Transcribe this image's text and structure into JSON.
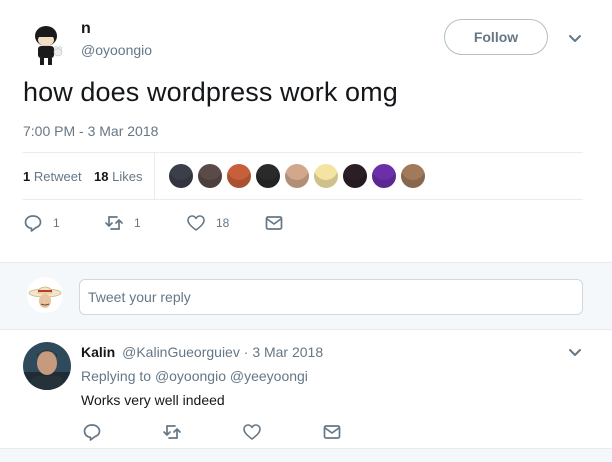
{
  "tweet": {
    "author_name": "n",
    "author_handle": "@oyoongio",
    "follow_label": "Follow",
    "text": "how does wordpress work omg",
    "timestamp": "7:00 PM - 3 Mar 2018",
    "retweets_count": "1",
    "retweets_label": "Retweet",
    "likes_count": "18",
    "likes_label": "Likes",
    "actions": {
      "reply_count": "1",
      "retweet_count": "1",
      "like_count": "18"
    },
    "liker_avatars": [
      "#3b3f4a",
      "#5a4a48",
      "#c7603a",
      "#2a2a2a",
      "#d2a78c",
      "#f4e3a1",
      "#2b1f25",
      "#6b2fa8",
      "#a07a5a"
    ]
  },
  "reply_box": {
    "placeholder": "Tweet your reply"
  },
  "reply": {
    "author_name": "Kalin",
    "author_handle": "@KalinGueorguiev",
    "separator": "·",
    "date": "3 Mar 2018",
    "replying_to_label": "Replying to",
    "replying_to_users": [
      "@oyoongio",
      "@yeeyoongi"
    ],
    "text": "Works very well indeed"
  },
  "colors": {
    "text_primary": "#14171a",
    "text_secondary": "#657786",
    "border": "#e6ecf0",
    "background_alt": "#f5f8fa"
  }
}
